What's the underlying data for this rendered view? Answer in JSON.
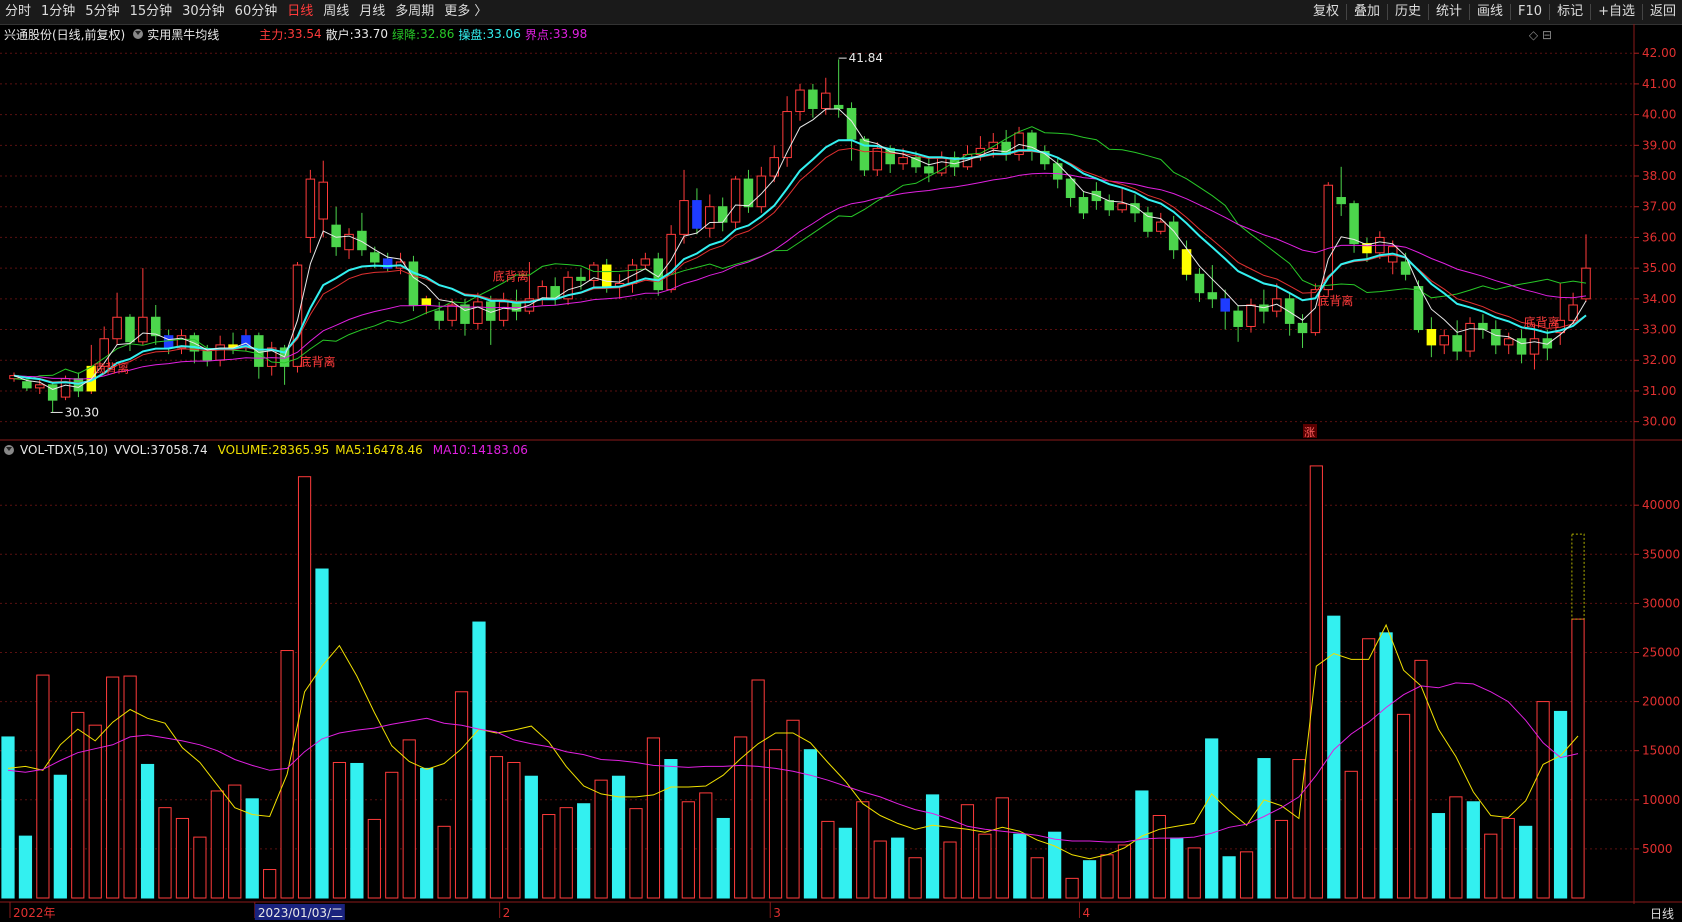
{
  "toolbar": {
    "periods": [
      "分时",
      "1分钟",
      "5分钟",
      "15分钟",
      "30分钟",
      "60分钟",
      "日线",
      "周线",
      "月线",
      "多周期",
      "更多 〉"
    ],
    "active_period": "日线",
    "actions": [
      "复权",
      "叠加",
      "历史",
      "统计",
      "画线",
      "F10",
      "标记",
      "+自选",
      "返回"
    ]
  },
  "stock": {
    "title": "兴通股份(日线,前复权)",
    "indicator": "实用黑牛均线"
  },
  "main_indicators": {
    "zhuli_label": "主力:",
    "zhuli": "33.54",
    "sanhu_label": "散户:",
    "sanhu": "33.70",
    "lvjiang_label": "绿降:",
    "lvjiang": "32.86",
    "caopan_label": "操盘:",
    "caopan": "33.06",
    "jiedian_label": "界点:",
    "jiedian": "33.98"
  },
  "volume_indicators": {
    "name": "VOL-TDX(5,10)",
    "vvol_label": "VVOL:",
    "vvol": "37058.74",
    "volume_label": "VOLUME:",
    "volume": "28365.95",
    "ma5_label": "MA5:",
    "ma5": "16478.46",
    "ma10_label": "MA10:",
    "ma10": "14183.06"
  },
  "price_axis": [
    "42.00",
    "41.00",
    "40.00",
    "39.00",
    "38.00",
    "37.00",
    "36.00",
    "35.00",
    "34.00",
    "33.00",
    "32.00",
    "31.00",
    "30.00"
  ],
  "volume_axis": [
    "40000",
    "35000",
    "30000",
    "25000",
    "20000",
    "15000",
    "10000",
    "5000"
  ],
  "x_axis": [
    "2022年",
    "2023/01/03/二",
    "2",
    "3",
    "4"
  ],
  "annotations": {
    "high": "41.84",
    "low": "30.30",
    "signal": "底背离",
    "zhang": "涨"
  },
  "footer": {
    "period": "日线"
  },
  "colors": {
    "up": "#ff3b3b",
    "down": "#4cd54c",
    "cyan": "#33f0f0",
    "yellow": "#ffff00",
    "magenta": "#e020e0",
    "white": "#e8e8e8",
    "red_line": "#e03030",
    "green_line": "#28c828",
    "blue": "#1e3cff"
  },
  "chart_data": {
    "type": "candlestick",
    "price_range": [
      29.5,
      42.3
    ],
    "volume_range": [
      0,
      44500
    ],
    "candles": [
      [
        31.4,
        31.5,
        31.3,
        31.6
      ],
      [
        31.3,
        31.1,
        31.0,
        31.4
      ],
      [
        31.1,
        31.2,
        30.9,
        31.4
      ],
      [
        31.2,
        30.7,
        30.3,
        31.3
      ],
      [
        30.8,
        31.4,
        30.7,
        31.5
      ],
      [
        31.4,
        31.0,
        30.8,
        31.6
      ],
      [
        31.0,
        31.8,
        30.9,
        32.5
      ],
      [
        31.8,
        32.7,
        31.6,
        33.1
      ],
      [
        32.7,
        33.4,
        32.5,
        34.2
      ],
      [
        33.4,
        32.6,
        32.3,
        33.5
      ],
      [
        32.6,
        33.4,
        32.5,
        35.0
      ],
      [
        33.4,
        32.8,
        32.5,
        33.8
      ],
      [
        32.8,
        32.4,
        32.2,
        33.0
      ],
      [
        32.4,
        32.8,
        32.2,
        33.0
      ],
      [
        32.8,
        32.3,
        31.9,
        32.9
      ],
      [
        32.3,
        32.0,
        31.8,
        32.5
      ],
      [
        32.0,
        32.5,
        31.8,
        32.8
      ],
      [
        32.5,
        32.4,
        32.2,
        32.9
      ],
      [
        32.4,
        32.8,
        32.3,
        33.0
      ],
      [
        32.8,
        31.8,
        31.4,
        32.9
      ],
      [
        31.8,
        32.4,
        31.5,
        32.6
      ],
      [
        32.4,
        31.8,
        31.2,
        32.5
      ],
      [
        31.8,
        35.1,
        31.6,
        35.2
      ],
      [
        36.0,
        37.9,
        35.5,
        38.2
      ],
      [
        36.6,
        37.8,
        36.0,
        38.5
      ],
      [
        36.4,
        35.7,
        35.4,
        37.0
      ],
      [
        35.6,
        36.1,
        35.3,
        36.3
      ],
      [
        36.2,
        35.6,
        35.4,
        36.8
      ],
      [
        35.5,
        35.2,
        35.0,
        35.7
      ],
      [
        35.3,
        35.0,
        34.9,
        35.5
      ],
      [
        35.0,
        35.2,
        34.8,
        35.5
      ],
      [
        35.2,
        33.8,
        33.6,
        35.4
      ],
      [
        33.8,
        34.0,
        33.5,
        34.1
      ],
      [
        33.6,
        33.3,
        33.0,
        33.9
      ],
      [
        33.3,
        33.8,
        33.1,
        34.0
      ],
      [
        33.8,
        33.2,
        32.8,
        34.0
      ],
      [
        33.2,
        33.9,
        33.0,
        34.2
      ],
      [
        33.9,
        33.3,
        32.5,
        34.1
      ],
      [
        33.3,
        33.9,
        33.1,
        34.2
      ],
      [
        33.9,
        33.6,
        33.3,
        34.3
      ],
      [
        33.6,
        34.0,
        33.5,
        35.2
      ],
      [
        34.0,
        34.4,
        33.8,
        34.6
      ],
      [
        34.4,
        34.0,
        33.8,
        34.7
      ],
      [
        34.0,
        34.7,
        33.8,
        34.9
      ],
      [
        34.7,
        34.6,
        34.3,
        35.0
      ],
      [
        34.6,
        35.1,
        34.4,
        35.2
      ],
      [
        35.1,
        34.4,
        34.2,
        35.3
      ],
      [
        34.4,
        34.5,
        34.0,
        34.8
      ],
      [
        34.5,
        35.1,
        34.2,
        35.3
      ],
      [
        35.1,
        35.3,
        35.0,
        35.5
      ],
      [
        35.3,
        34.3,
        34.1,
        35.5
      ],
      [
        34.3,
        36.1,
        34.2,
        36.4
      ],
      [
        36.1,
        37.2,
        35.8,
        38.2
      ],
      [
        37.2,
        36.3,
        36.1,
        37.6
      ],
      [
        36.3,
        37.0,
        36.0,
        37.4
      ],
      [
        37.0,
        36.5,
        36.2,
        37.3
      ],
      [
        36.5,
        37.9,
        36.3,
        38.0
      ],
      [
        37.9,
        37.0,
        36.8,
        38.2
      ],
      [
        37.0,
        38.0,
        36.8,
        38.3
      ],
      [
        38.0,
        38.6,
        37.8,
        39.0
      ],
      [
        38.6,
        40.1,
        38.3,
        40.6
      ],
      [
        40.1,
        40.8,
        39.8,
        41.0
      ],
      [
        40.8,
        40.2,
        39.9,
        41.0
      ],
      [
        40.2,
        40.7,
        40.0,
        41.2
      ],
      [
        40.3,
        40.2,
        39.9,
        41.8
      ],
      [
        40.2,
        39.2,
        38.5,
        40.4
      ],
      [
        39.2,
        38.2,
        38.0,
        39.3
      ],
      [
        38.2,
        38.9,
        38.0,
        39.1
      ],
      [
        38.9,
        38.4,
        38.1,
        39.0
      ],
      [
        38.4,
        38.6,
        38.2,
        38.9
      ],
      [
        38.6,
        38.3,
        38.1,
        38.8
      ],
      [
        38.3,
        38.1,
        37.8,
        38.6
      ],
      [
        38.1,
        38.6,
        38.0,
        38.8
      ],
      [
        38.6,
        38.3,
        38.0,
        38.8
      ],
      [
        38.3,
        38.7,
        38.2,
        39.0
      ],
      [
        38.7,
        38.9,
        38.5,
        39.3
      ],
      [
        38.9,
        39.1,
        38.6,
        39.4
      ],
      [
        39.1,
        38.7,
        38.5,
        39.5
      ],
      [
        38.7,
        39.4,
        38.5,
        39.6
      ],
      [
        39.4,
        38.8,
        38.5,
        39.5
      ],
      [
        38.8,
        38.4,
        38.2,
        39.0
      ],
      [
        38.4,
        37.9,
        37.6,
        38.6
      ],
      [
        37.9,
        37.3,
        37.0,
        38.0
      ],
      [
        37.3,
        36.8,
        36.6,
        37.5
      ],
      [
        37.5,
        37.2,
        36.9,
        37.8
      ],
      [
        37.2,
        36.9,
        36.7,
        37.4
      ],
      [
        36.9,
        37.1,
        36.8,
        37.6
      ],
      [
        37.1,
        36.8,
        36.5,
        37.4
      ],
      [
        36.8,
        36.2,
        36.0,
        37.0
      ],
      [
        36.2,
        36.5,
        36.1,
        36.8
      ],
      [
        36.5,
        35.6,
        35.3,
        36.7
      ],
      [
        35.6,
        34.8,
        34.6,
        35.9
      ],
      [
        34.8,
        34.2,
        33.9,
        35.0
      ],
      [
        34.2,
        34.0,
        33.7,
        35.1
      ],
      [
        34.0,
        33.6,
        33.0,
        34.3
      ],
      [
        33.6,
        33.1,
        32.6,
        33.8
      ],
      [
        33.1,
        33.8,
        32.9,
        34.0
      ],
      [
        33.8,
        33.6,
        33.2,
        34.3
      ],
      [
        33.6,
        34.0,
        33.4,
        34.5
      ],
      [
        34.0,
        33.2,
        32.8,
        34.2
      ],
      [
        33.2,
        32.9,
        32.4,
        33.5
      ],
      [
        32.9,
        34.3,
        32.8,
        34.5
      ],
      [
        34.3,
        37.7,
        34.1,
        37.8
      ],
      [
        37.3,
        37.1,
        36.7,
        38.3
      ],
      [
        37.1,
        35.8,
        35.5,
        37.2
      ],
      [
        35.8,
        35.5,
        35.2,
        36.0
      ],
      [
        35.5,
        36.0,
        35.3,
        36.2
      ],
      [
        35.2,
        35.7,
        34.8,
        35.9
      ],
      [
        35.2,
        34.8,
        34.6,
        35.5
      ],
      [
        34.4,
        33.0,
        32.9,
        34.6
      ],
      [
        33.0,
        32.5,
        32.1,
        33.4
      ],
      [
        32.5,
        32.8,
        32.2,
        33.0
      ],
      [
        32.8,
        32.3,
        32.0,
        33.3
      ],
      [
        32.3,
        33.2,
        32.1,
        33.4
      ],
      [
        33.2,
        33.0,
        32.7,
        33.5
      ],
      [
        33.0,
        32.5,
        32.2,
        33.3
      ],
      [
        32.5,
        32.7,
        32.2,
        32.9
      ],
      [
        32.7,
        32.2,
        31.9,
        33.0
      ],
      [
        32.2,
        32.7,
        31.7,
        33.2
      ],
      [
        32.7,
        32.4,
        32.0,
        33.0
      ],
      [
        32.9,
        33.3,
        32.5,
        34.5
      ],
      [
        33.3,
        33.8,
        33.2,
        34.2
      ],
      [
        34.0,
        35.0,
        33.9,
        36.1
      ]
    ],
    "special_candles": {
      "yellow": [
        6,
        17,
        32,
        46,
        91,
        105,
        110
      ],
      "blue": [
        12,
        18,
        29,
        53,
        94
      ]
    },
    "volumes": [
      16400,
      6300,
      22700,
      12500,
      18900,
      17600,
      22500,
      22600,
      13600,
      9200,
      8100,
      6200,
      10900,
      11500,
      10100,
      2900,
      25200,
      42900,
      33500,
      13800,
      13700,
      8000,
      12800,
      16100,
      13200,
      7300,
      21000,
      28100,
      14400,
      13800,
      12400,
      8500,
      9200,
      9600,
      12000,
      12400,
      9100,
      16300,
      14100,
      9800,
      10700,
      8100,
      16400,
      22200,
      15100,
      18100,
      15100,
      7800,
      7100,
      9800,
      5800,
      6100,
      4100,
      10500,
      5700,
      9500,
      6500,
      10200,
      6500,
      4100,
      6700,
      2000,
      3800,
      4400,
      5400,
      10900,
      8400,
      6100,
      5100,
      16200,
      4200,
      4700,
      14200,
      7900,
      14100,
      44000,
      28700,
      12900,
      26400,
      27000,
      18700,
      24200,
      8600,
      10300,
      9800,
      6500,
      8100,
      7300,
      20000,
      19000,
      28400
    ],
    "volume_down": [
      0,
      1,
      3,
      8,
      14,
      18,
      20,
      24,
      27,
      30,
      33,
      35,
      38,
      41,
      46,
      48,
      51,
      53,
      58,
      60,
      62,
      65,
      67,
      69,
      70,
      72,
      76,
      79,
      82,
      84,
      87,
      89
    ],
    "ma5_vol": [
      13200,
      13400,
      13000,
      15600,
      17200,
      16000,
      17900,
      19200,
      18300,
      17800,
      15300,
      13800,
      11500,
      9200,
      8500,
      8300,
      12600,
      21000,
      23600,
      25700,
      22600,
      18900,
      15500,
      13900,
      13100,
      13700,
      15200,
      17200,
      16800,
      17100,
      17500,
      15900,
      13400,
      11400,
      10600,
      10300,
      10300,
      10500,
      11300,
      11300,
      11400,
      12500,
      14200,
      15700,
      16800,
      16800,
      15800,
      13800,
      11900,
      9600,
      8400,
      7600,
      7000,
      7400,
      7200,
      7000,
      6700,
      7200,
      6800,
      5900,
      5300,
      4400,
      4000,
      4400,
      5100,
      6300,
      7000,
      7300,
      7600,
      10600,
      8900,
      7400,
      10000,
      9400,
      8100,
      23600,
      24900,
      24300,
      24300,
      27800,
      23200,
      21600,
      17200,
      14400,
      10800,
      8400,
      8200,
      9900,
      13600,
      14500,
      16500
    ],
    "ma10_vol": [
      13000,
      12800,
      13100,
      14000,
      14800,
      15200,
      15600,
      16400,
      16600,
      16300,
      16000,
      15600,
      15000,
      14100,
      13500,
      13000,
      13200,
      14900,
      16200,
      16800,
      17100,
      17300,
      17700,
      18000,
      18300,
      17800,
      17600,
      17200,
      16900,
      16100,
      15700,
      15400,
      14900,
      14600,
      14100,
      14000,
      13800,
      13500,
      13400,
      13300,
      13400,
      13400,
      13500,
      13400,
      13200,
      12900,
      12500,
      12000,
      11400,
      10800,
      10300,
      9600,
      9000,
      8600,
      8000,
      7300,
      7000,
      6800,
      6600,
      6400,
      6000,
      5800,
      5800,
      5700,
      5700,
      6000,
      6100,
      6100,
      6200,
      6600,
      7200,
      7500,
      8300,
      9200,
      10300,
      12500,
      15100,
      16700,
      17900,
      19400,
      20700,
      21600,
      21400,
      21900,
      21800,
      21000,
      20000,
      18100,
      15800,
      14300,
      14700
    ]
  }
}
